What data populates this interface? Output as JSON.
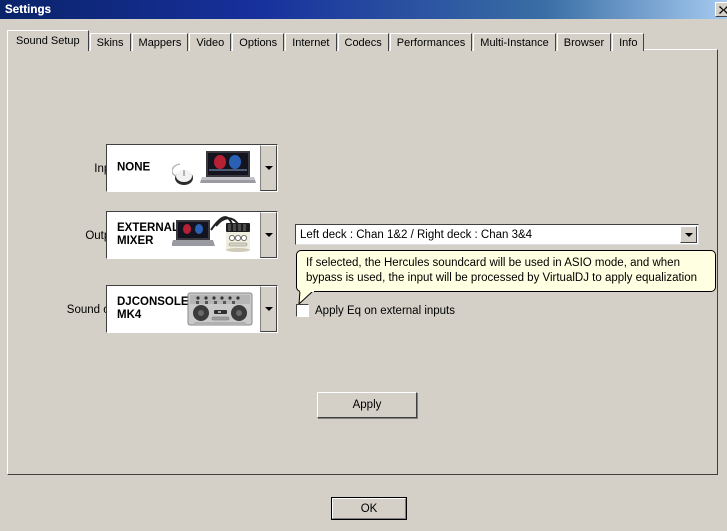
{
  "window": {
    "title": "Settings",
    "close_icon": "close-icon",
    "close_label": "╳"
  },
  "tabs": [
    {
      "label": "Sound Setup",
      "active": true
    },
    {
      "label": "Skins",
      "active": false
    },
    {
      "label": "Mappers",
      "active": false
    },
    {
      "label": "Video",
      "active": false
    },
    {
      "label": "Options",
      "active": false
    },
    {
      "label": "Internet",
      "active": false
    },
    {
      "label": "Codecs",
      "active": false
    },
    {
      "label": "Performances",
      "active": false
    },
    {
      "label": "Multi-Instance",
      "active": false
    },
    {
      "label": "Browser",
      "active": false
    },
    {
      "label": "Info",
      "active": false
    }
  ],
  "sound_setup": {
    "inputs": {
      "label": "Inputs :",
      "value": "NONE",
      "art": "laptop-mouse-icon",
      "dropdown_icon": "chevron-down-icon"
    },
    "outputs": {
      "label": "Outputs :",
      "value": "EXTERNAL\nMIXER",
      "art": "laptop-mixer-icon",
      "dropdown_icon": "chevron-down-icon"
    },
    "soundcard": {
      "label": "Sound card :",
      "value": "DJCONSOLE\nMK4",
      "art": "dj-controller-icon",
      "dropdown_icon": "chevron-down-icon"
    },
    "routing": {
      "value": "Left deck : Chan 1&2 / Right deck : Chan 3&4",
      "dropdown_icon": "chevron-down-icon"
    },
    "tooltip": {
      "text": "If selected, the Hercules soundcard will be used in ASIO mode, and when bypass is used, the input will be processed by VirtualDJ to apply equalization"
    },
    "eq_checkbox": {
      "label": "Apply Eq on external inputs",
      "checked": false
    },
    "apply_button": "Apply"
  },
  "footer": {
    "ok_button": "OK"
  },
  "colors": {
    "face": "#d4d0c8",
    "title_start": "#0a246a",
    "title_end": "#a6caf0",
    "tooltip_bg": "#ffffe1",
    "field_bg": "#ffffff"
  }
}
